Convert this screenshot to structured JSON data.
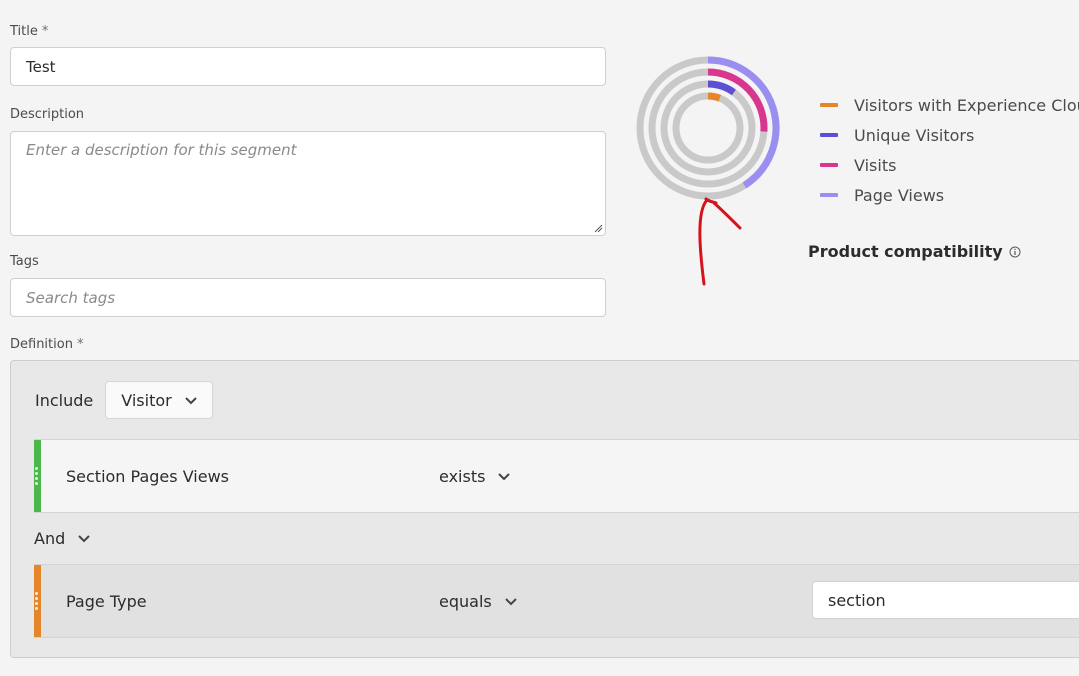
{
  "form": {
    "title_label": "Title",
    "required_mark": "*",
    "title_value": "Test",
    "description_label": "Description",
    "description_placeholder": "Enter a description for this segment",
    "tags_label": "Tags",
    "tags_placeholder": "Search tags",
    "definition_label": "Definition"
  },
  "definition": {
    "include_label": "Include",
    "scope_value": "Visitor",
    "rules": [
      {
        "name": "Section Pages Views",
        "operator": "exists",
        "value": "",
        "color": "#4ab84a"
      },
      {
        "name": "Page Type",
        "operator": "equals",
        "value": "section",
        "color": "#e6862b"
      }
    ],
    "conjunction": "And"
  },
  "chart_data": {
    "type": "radial-progress",
    "series": [
      {
        "name": "Visitors with Experience Cloud I",
        "color": "#e6862b",
        "fraction": 0.06
      },
      {
        "name": "Unique Visitors",
        "color": "#5c4fd6",
        "fraction": 0.1
      },
      {
        "name": "Visits",
        "color": "#d9378f",
        "fraction": 0.26
      },
      {
        "name": "Page Views",
        "color": "#9a8ff0",
        "fraction": 0.41
      }
    ]
  },
  "product_compatibility_label": "Product compatibility",
  "icons": {
    "chevron": "chevron-down-icon",
    "info": "info-icon",
    "grip": "drag-handle-icon",
    "annotation": "red-arrow-annotation"
  },
  "colors": {
    "background": "#f4f4f4",
    "track": "#c9c9c9",
    "annotation": "#d4141c"
  }
}
